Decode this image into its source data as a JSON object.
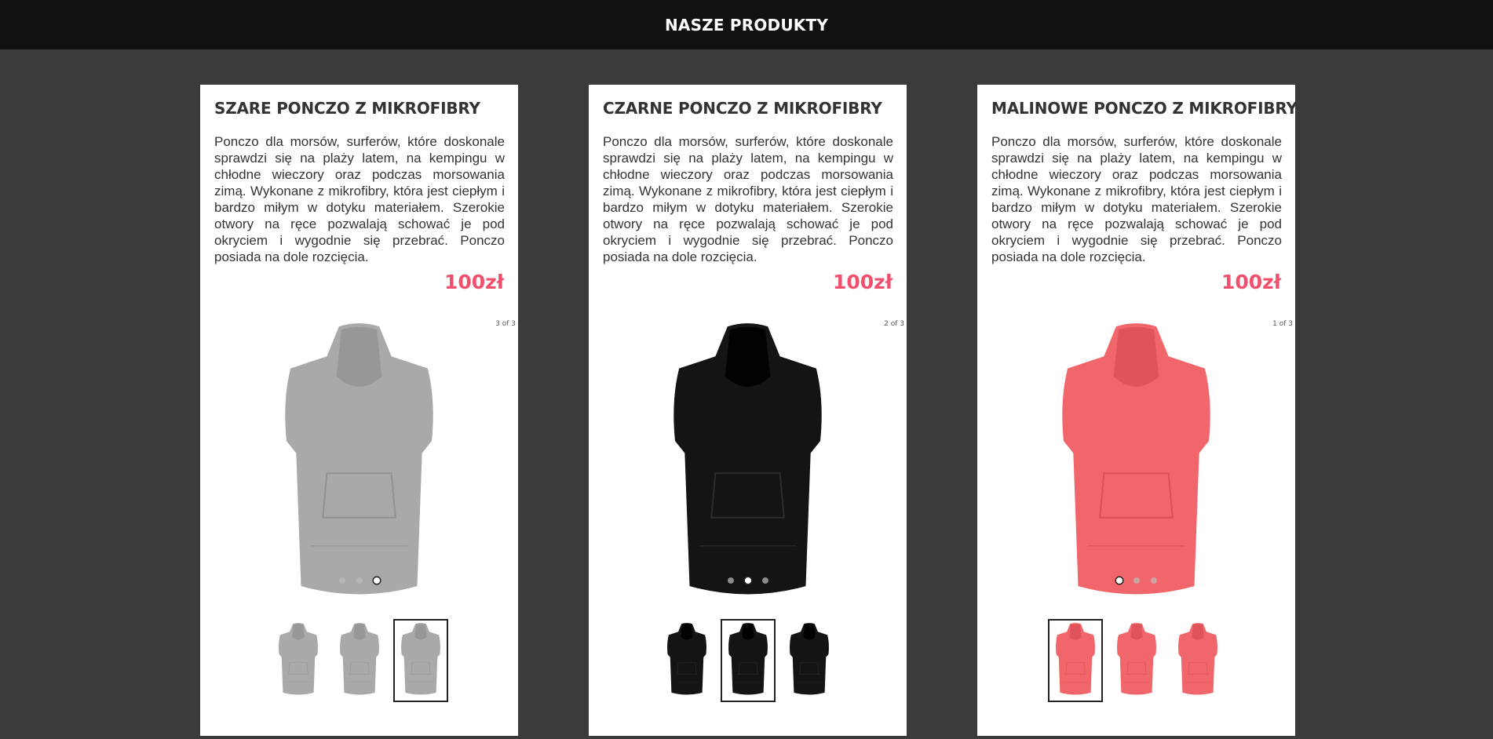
{
  "header": {
    "title": "NASZE PRODUKTY"
  },
  "products": [
    {
      "title": "SZARE PONCZO Z MIKROFIBRY",
      "description": "Ponczo dla morsów, surferów, które doskonale sprawdzi się na plaży latem, na kempingu w chłodne wieczory oraz podczas morsowania zimą. Wykonane z mikrofibry, która jest ciepłym i bardzo miłym w dotyku materiałem. Szerokie otwory na ręce pozwalają schować je pod okryciem i wygodnie się przebrać. Ponczo posiada na dole rozcięcia.",
      "price": "100zł",
      "counter": "3 of 3",
      "color": "#a9a9a9",
      "active_slide": 3,
      "total_slides": 3
    },
    {
      "title": "CZARNE PONCZO Z MIKROFIBRY",
      "description": "Ponczo dla morsów, surferów, które doskonale sprawdzi się na plaży latem, na kempingu w chłodne wieczory oraz podczas morsowania zimą. Wykonane z mikrofibry, która jest ciepłym i bardzo miłym w dotyku materiałem. Szerokie otwory na ręce pozwalają schować je pod okryciem i wygodnie się przebrać. Ponczo posiada na dole rozcięcia.",
      "price": "100zł",
      "counter": "2 of 3",
      "color": "#141414",
      "active_slide": 2,
      "total_slides": 3
    },
    {
      "title": "MALINOWE PONCZO Z MIKROFIBRY",
      "description": "Ponczo dla morsów, surferów, które doskonale sprawdzi się na plaży latem, na kempingu w chłodne wieczory oraz podczas morsowania zimą. Wykonane z mikrofibry, która jest ciepłym i bardzo miłym w dotyku materiałem. Szerokie otwory na ręce pozwalają schować je pod okryciem i wygodnie się przebrać. Ponczo posiada na dole rozcięcia.",
      "price": "100zł",
      "counter": "1 of 3",
      "color": "#f0666a",
      "active_slide": 1,
      "total_slides": 3
    }
  ]
}
